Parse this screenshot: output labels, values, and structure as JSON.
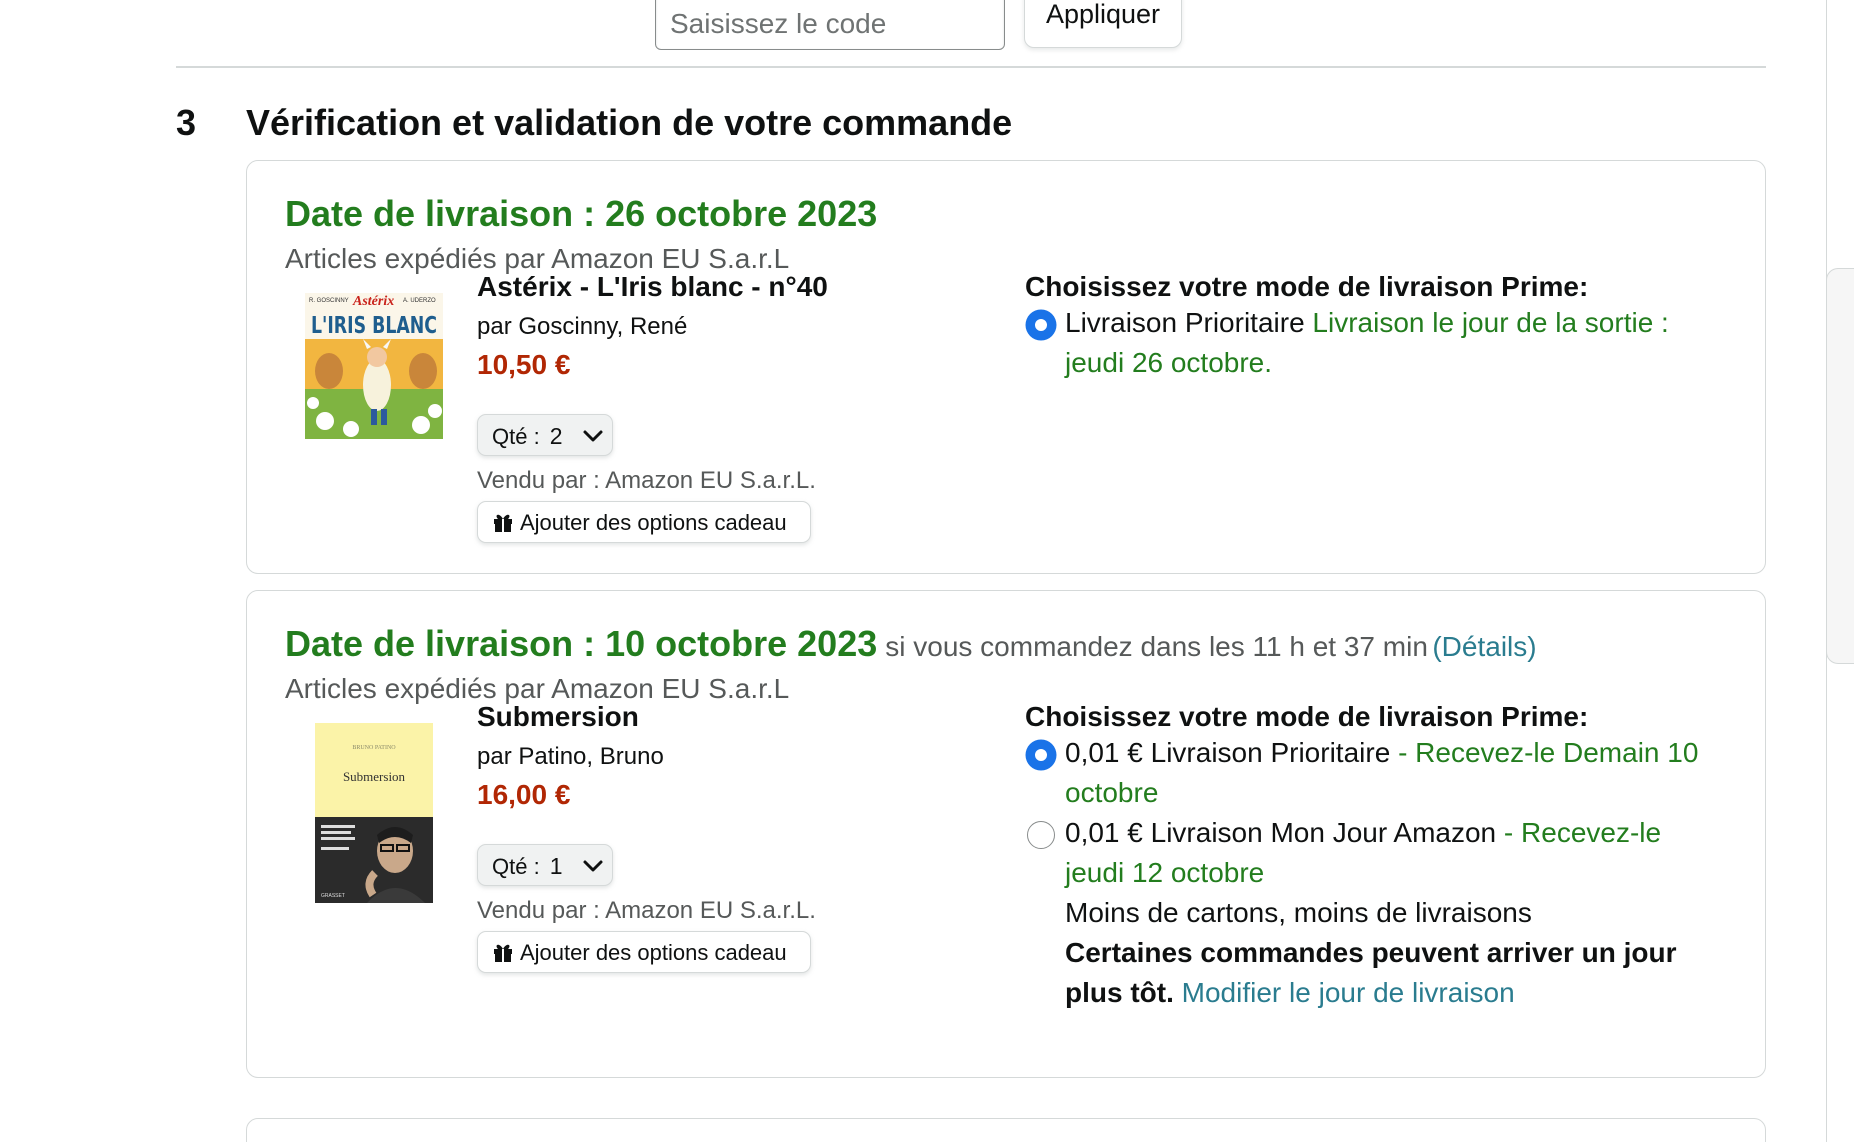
{
  "promo": {
    "placeholder": "Saisissez le code",
    "apply_label": "Appliquer"
  },
  "section": {
    "step_number": "3",
    "title": "Vérification et validation de votre commande"
  },
  "shipments": [
    {
      "delivery_date": "Date de livraison : 26 octobre 2023",
      "shipper": "Articles expédiés par Amazon EU S.a.r.L",
      "item": {
        "cover_icon": "book-cover-asterix",
        "cover_header_left": "R. GOSCINNY",
        "cover_header_brand": "Astérix",
        "cover_header_right": "A. UDERZO",
        "cover_title": "L'IRIS BLANC",
        "title": "Astérix - L'Iris blanc - n°40",
        "author": "par Goscinny, René",
        "price": "10,50 €",
        "qty_label": "Qté :",
        "qty_value": "2",
        "sold_by": "Vendu par : Amazon EU S.a.r.L.",
        "gift_label": "Ajouter des options cadeau"
      },
      "shipping": {
        "heading": "Choisissez votre mode de livraison Prime:",
        "options": [
          {
            "selected": true,
            "label": "Livraison Prioritaire",
            "promise": "Livraison le jour de la sortie : jeudi 26 octobre."
          }
        ]
      }
    },
    {
      "delivery_date": "Date de livraison : 10 octobre 2023",
      "cutoff": "si vous commandez dans les 11 h et 37 min",
      "details_link": "(Détails)",
      "shipper": "Articles expédiés par Amazon EU S.a.r.L",
      "item": {
        "cover_icon": "book-cover-submersion",
        "cover_author": "BRUNO PATINO",
        "cover_title": "Submersion",
        "cover_publisher": "GRASSET",
        "title": "Submersion",
        "author": "par Patino, Bruno",
        "price": "16,00 €",
        "qty_label": "Qté :",
        "qty_value": "1",
        "sold_by": "Vendu par : Amazon EU S.a.r.L.",
        "gift_label": "Ajouter des options cadeau"
      },
      "shipping": {
        "heading": "Choisissez votre mode de livraison Prime:",
        "options": [
          {
            "selected": true,
            "label": "0,01 € Livraison Prioritaire",
            "promise": "- Recevez-le Demain 10 octobre"
          },
          {
            "selected": false,
            "label": "0,01 € Livraison Mon Jour Amazon",
            "promise": "- Recevez-le jeudi 12 octobre",
            "note": "Moins de cartons, moins de livraisons",
            "note_bold": "Certaines commandes peuvent arriver un jour plus tôt.",
            "modify_link": "Modifier le jour de livraison"
          }
        ]
      }
    }
  ],
  "colors": {
    "delivery_green": "#237d1e",
    "price_red": "#b12704",
    "link_teal": "#2a7c8f",
    "radio_blue": "#1a73e8",
    "muted_text": "#565959",
    "border": "#d5d9d9"
  },
  "icons": {
    "qty_dropdown": "chevron-down-icon",
    "gift": "gift-icon"
  }
}
